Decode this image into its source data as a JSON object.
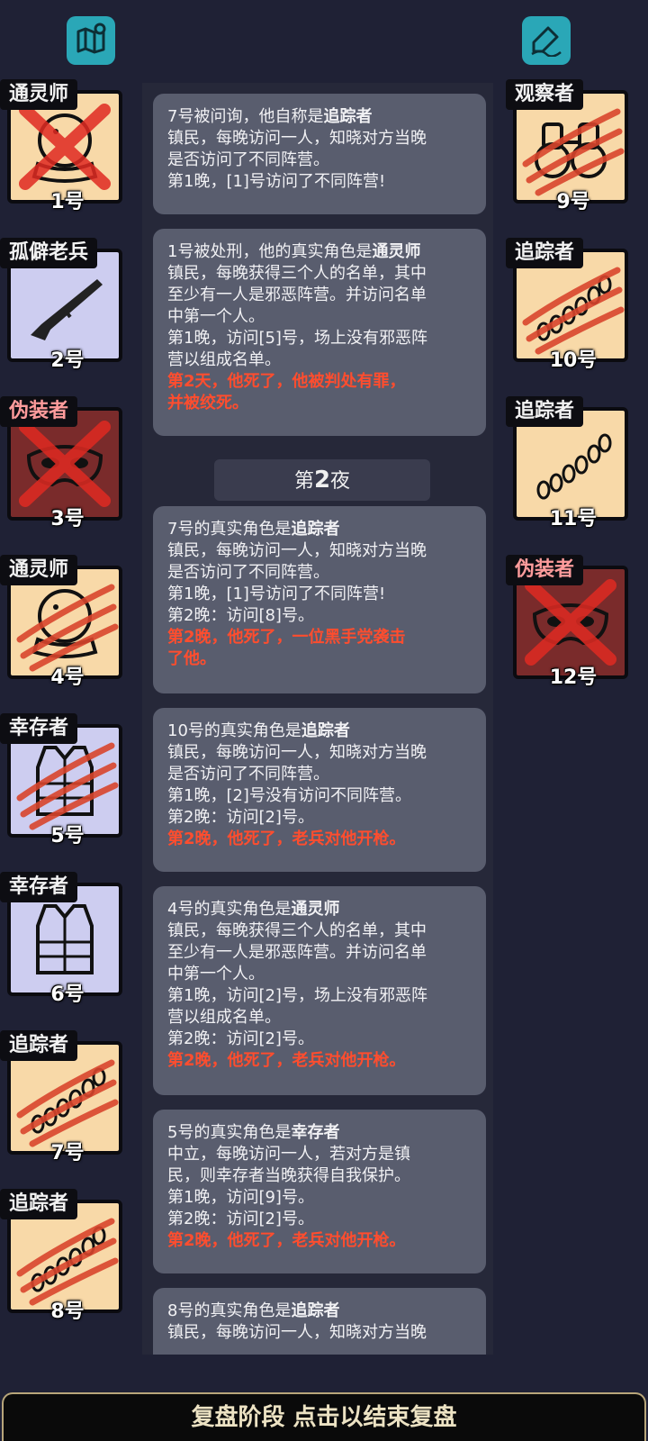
{
  "top_icons": {
    "left": "map-icon",
    "right": "note-pen-icon"
  },
  "players": [
    {
      "num": "1号",
      "role": "通灵师",
      "card": "town",
      "role_red": false,
      "icon": "crystal-ball-icon",
      "status": "executed"
    },
    {
      "num": "2号",
      "role": "孤僻老兵",
      "card": "blue",
      "role_red": false,
      "icon": "rifle-icon",
      "status": "alive"
    },
    {
      "num": "3号",
      "role": "伪装者",
      "card": "evil",
      "role_red": true,
      "icon": "mask-icon",
      "status": "executed"
    },
    {
      "num": "4号",
      "role": "通灵师",
      "card": "town",
      "role_red": false,
      "icon": "crystal-ball-icon",
      "status": "killed"
    },
    {
      "num": "5号",
      "role": "幸存者",
      "card": "blue",
      "role_red": false,
      "icon": "vest-icon",
      "status": "killed"
    },
    {
      "num": "6号",
      "role": "幸存者",
      "card": "blue",
      "role_red": false,
      "icon": "vest-icon",
      "status": "alive"
    },
    {
      "num": "7号",
      "role": "追踪者",
      "card": "town",
      "role_red": false,
      "icon": "footprints-icon",
      "status": "killed"
    },
    {
      "num": "8号",
      "role": "追踪者",
      "card": "town",
      "role_red": false,
      "icon": "footprints-icon",
      "status": "killed"
    },
    {
      "num": "9号",
      "role": "观察者",
      "card": "town",
      "role_red": false,
      "icon": "binoculars-icon",
      "status": "killed"
    },
    {
      "num": "10号",
      "role": "追踪者",
      "card": "town",
      "role_red": false,
      "icon": "footprints-icon",
      "status": "killed"
    },
    {
      "num": "11号",
      "role": "追踪者",
      "card": "town",
      "role_red": false,
      "icon": "footprints-icon",
      "status": "alive"
    },
    {
      "num": "12号",
      "role": "伪装者",
      "card": "evil",
      "role_red": true,
      "icon": "mask-icon",
      "status": "executed"
    }
  ],
  "feed": {
    "m1": {
      "prefix": "7号被问询，他自称是",
      "role": "追踪者",
      "lines": [
        "镇民，每晚访问一人，知晓对方当晚",
        "是否访问了不同阵营。",
        "第1晚，[1]号访问了不同阵营!"
      ]
    },
    "m2": {
      "prefix": "1号被处刑，他的真实角色是",
      "role": "通灵师",
      "lines": [
        "镇民，每晚获得三个人的名单，其中",
        "至少有一人是邪恶阵营。并访问名单",
        "中第一个人。",
        "第1晚，访问[5]号，场上没有邪恶阵",
        "营以组成名单。"
      ],
      "death": [
        "第2天，他死了，他被判处有罪，",
        "并被绞死。"
      ]
    },
    "night": {
      "pre": "第",
      "num": "2",
      "post": "夜"
    },
    "m3": {
      "prefix": "7号的真实角色是",
      "role": "追踪者",
      "lines": [
        "镇民，每晚访问一人，知晓对方当晚",
        "是否访问了不同阵营。",
        "第1晚，[1]号访问了不同阵营!",
        "第2晚：访问[8]号。"
      ],
      "death": [
        "第2晚，他死了，一位黑手党袭击",
        "了他。"
      ]
    },
    "m4": {
      "prefix": "10号的真实角色是",
      "role": "追踪者",
      "lines": [
        "镇民，每晚访问一人，知晓对方当晚",
        "是否访问了不同阵营。",
        "第1晚，[2]号没有访问不同阵营。",
        "第2晚：访问[2]号。"
      ],
      "death": [
        "第2晚，他死了，老兵对他开枪。"
      ]
    },
    "m5": {
      "prefix": "4号的真实角色是",
      "role": "通灵师",
      "lines": [
        "镇民，每晚获得三个人的名单，其中",
        "至少有一人是邪恶阵营。并访问名单",
        "中第一个人。",
        "第1晚，访问[2]号，场上没有邪恶阵",
        "营以组成名单。",
        "第2晚：访问[2]号。"
      ],
      "death": [
        "第2晚，他死了，老兵对他开枪。"
      ]
    },
    "m6": {
      "prefix": "5号的真实角色是",
      "role": "幸存者",
      "lines": [
        "中立，每晚访问一人，若对方是镇",
        "民，则幸存者当晚获得自我保护。",
        "第1晚，访问[9]号。",
        "第2晚：访问[2]号。"
      ],
      "death": [
        "第2晚，他死了，老兵对他开枪。"
      ]
    },
    "m7": {
      "prefix": "8号的真实角色是",
      "role": "追踪者",
      "lines": [
        "镇民，每晚访问一人，知晓对方当晚"
      ]
    }
  },
  "bottom_bar": "复盘阶段 点击以结束复盘",
  "colors": {
    "background": "#1f2135",
    "message_bg": "#595d6e",
    "death_text": "#ff4d2e",
    "evil_card": "#7a2b2b",
    "town_card": "#f8d9a8",
    "blue_card": "#cdcdf0",
    "icon_teal": "#2aa7b7"
  }
}
